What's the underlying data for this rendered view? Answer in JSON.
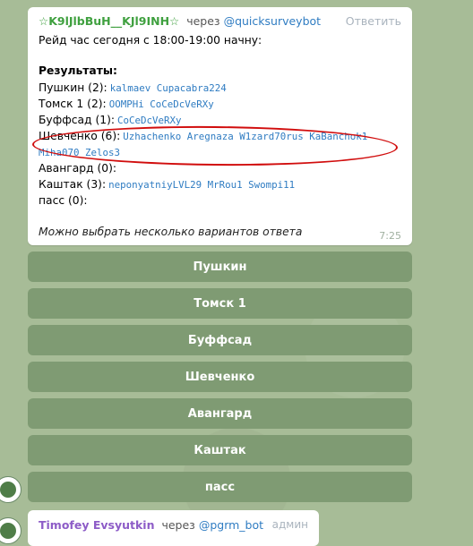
{
  "message": {
    "sender": "☆K9lJlbBuH__KJl9INH☆",
    "via_label": "через",
    "bot": "@quicksurveybot",
    "reply_label": "Ответить",
    "announcement": "Рейд час сегодня с 18:00-19:00 начну:",
    "results_heading": "Результаты:",
    "results": [
      {
        "option": "Пушкин (2):",
        "voters_line1": "kalmaev Cupacabra224",
        "voters_line2": ""
      },
      {
        "option": "Томск 1 (2):",
        "voters_line1": "OOMPHi CoCeDcVeRXy",
        "voters_line2": ""
      },
      {
        "option": "Буффсад (1):",
        "voters_line1": "CoCeDcVeRXy",
        "voters_line2": ""
      },
      {
        "option": "Шевченко (6):",
        "voters_line1": "Uzhachenko Aregnaza W1zard70rus KaBanchok1",
        "voters_line2": "Miha070 Zelos3"
      },
      {
        "option": "Авангард (0):",
        "voters_line1": "",
        "voters_line2": ""
      },
      {
        "option": "Каштак (3):",
        "voters_line1": "neponyatniyLVL29 MrRou1 Swompi11",
        "voters_line2": ""
      },
      {
        "option": "пасс (0):",
        "voters_line1": "",
        "voters_line2": ""
      }
    ],
    "footer_note": "Можно выбрать несколько вариантов ответа",
    "time": "7:25"
  },
  "buttons": [
    "Пушкин",
    "Томск 1",
    "Буффсад",
    "Шевченко",
    "Авангард",
    "Каштак",
    "пасс"
  ],
  "next_message": {
    "sender": "Timofey Evsyutkin",
    "via_label": "через",
    "bot": "@pgrm_bot",
    "role": "админ"
  },
  "colors": {
    "background": "#a7bc97",
    "button": "#7f9b73",
    "sender_green": "#3fa03f",
    "link_blue": "#2f7cc2",
    "annotation_red": "#d10d0d"
  }
}
